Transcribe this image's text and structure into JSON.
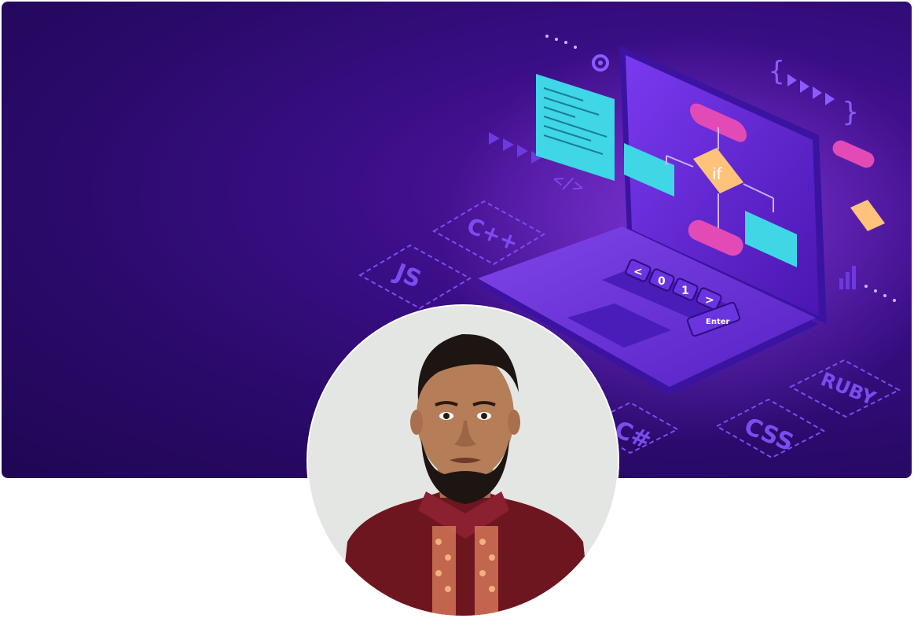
{
  "cover": {
    "tags": {
      "cpp": "C++",
      "js": "JS",
      "csharp": "C#",
      "css": "CSS",
      "ruby": "RUBY",
      "if": "if",
      "key_0": "0",
      "key_1": "1",
      "key_left": "<",
      "key_right": ">",
      "enter": "Enter",
      "code_tag": "</>"
    },
    "colors": {
      "background": "#2a0a6a",
      "accent_cyan": "#3fd6e6",
      "accent_pink": "#e24bb6",
      "accent_orange": "#ffc27a",
      "laptop": "#6a2ed6"
    }
  },
  "profile": {
    "avatar_icon": "profile-photo"
  }
}
